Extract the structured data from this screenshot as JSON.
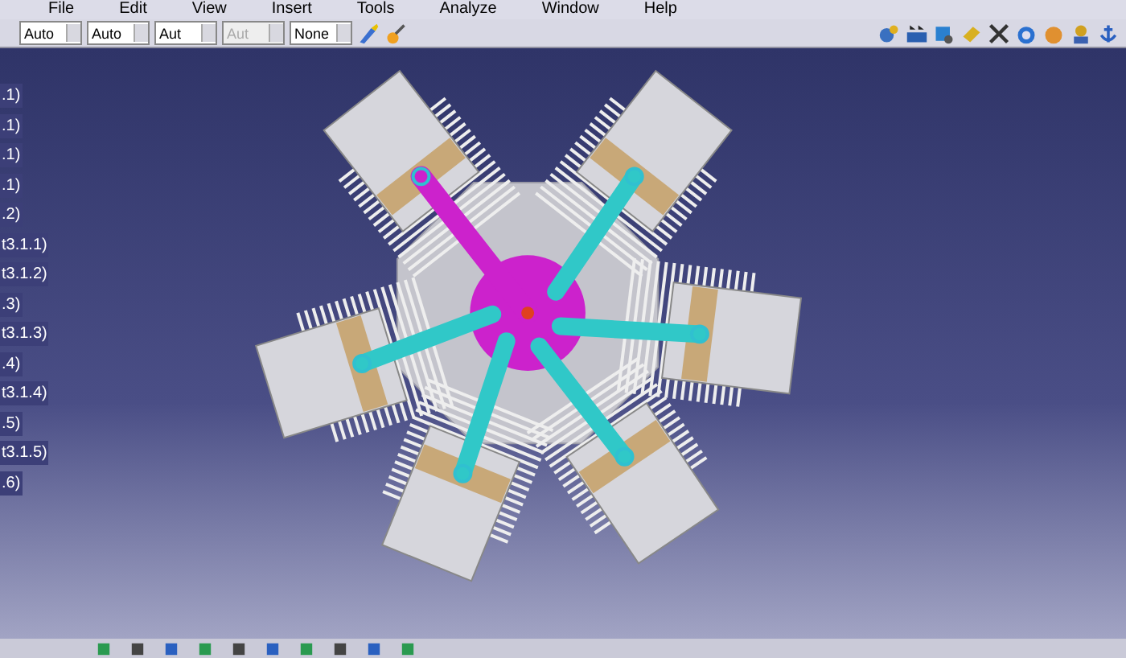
{
  "menu": [
    "File",
    "Edit",
    "View",
    "Insert",
    "Tools",
    "Analyze",
    "Window",
    "Help"
  ],
  "toolbar": {
    "dropdowns": [
      {
        "value": "Auto",
        "disabled": false
      },
      {
        "value": "Auto",
        "disabled": false
      },
      {
        "value": "Aut",
        "disabled": false
      },
      {
        "value": "Aut",
        "disabled": true
      },
      {
        "value": "None",
        "disabled": false
      }
    ]
  },
  "tree": {
    "items": [
      ".1)",
      ".1)",
      ".1)",
      ".1)",
      ".2)",
      "t3.1.1)",
      "t3.1.2)",
      ".3)",
      "t3.1.3)",
      ".4)",
      "t3.1.4)",
      ".5)",
      "t3.1.5)",
      ".6)"
    ]
  }
}
